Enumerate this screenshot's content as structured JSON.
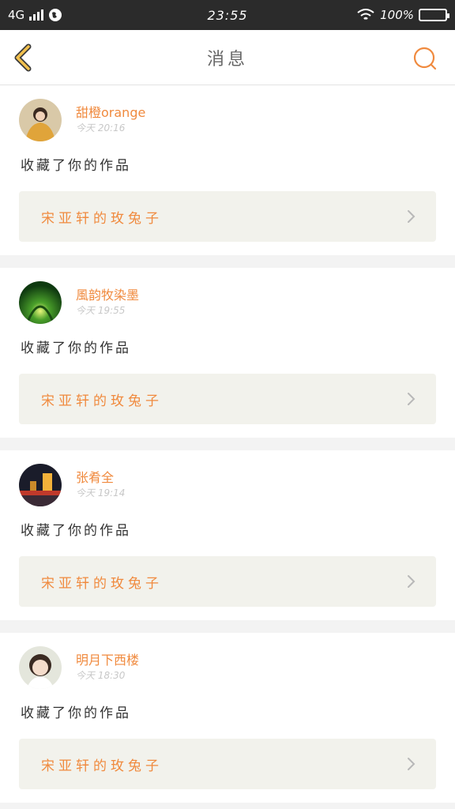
{
  "status_bar": {
    "network": "4G",
    "time": "23:55",
    "battery": "100%"
  },
  "header": {
    "title": "消息",
    "back_icon": "chevron-left-icon",
    "search_icon": "search-icon",
    "accent_color": "#f08a3e",
    "back_color": "#f2c14e"
  },
  "notifications": [
    {
      "username": "甜橙orange",
      "timestamp": "今天 20:16",
      "action": "收藏了你的作品",
      "work_title": "宋亚轩的玫兔子"
    },
    {
      "username": "風韵牧染墨",
      "timestamp": "今天 19:55",
      "action": "收藏了你的作品",
      "work_title": "宋亚轩的玫兔子"
    },
    {
      "username": "张肴全",
      "timestamp": "今天 19:14",
      "action": "收藏了你的作品",
      "work_title": "宋亚轩的玫兔子"
    },
    {
      "username": "明月下西楼",
      "timestamp": "今天 18:30",
      "action": "收藏了你的作品",
      "work_title": "宋亚轩的玫兔子"
    }
  ]
}
